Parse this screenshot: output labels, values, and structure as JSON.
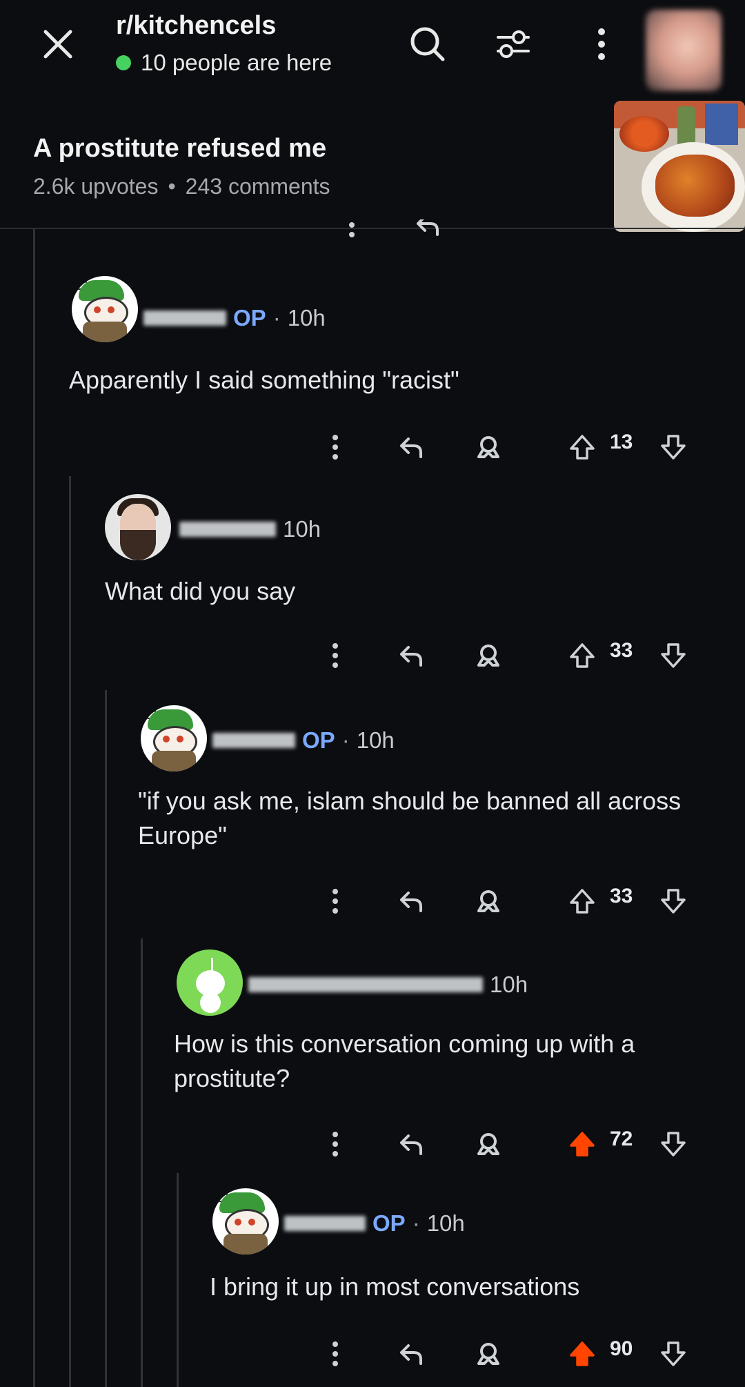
{
  "header": {
    "subreddit": "r/kitchencels",
    "online": "10 people are here",
    "post_title": "A prostitute refused me",
    "upvotes": "2.6k upvotes",
    "separator": "•",
    "comments": "243 comments",
    "accent_online": "#46d160"
  },
  "comments": [
    {
      "op": "OP",
      "time": "10h",
      "text": "Apparently I said something \"racist\"",
      "score": "13",
      "upvoted": false
    },
    {
      "op": "",
      "time": "10h",
      "text": "What did you say",
      "score": "33",
      "upvoted": false
    },
    {
      "op": "OP",
      "time": "10h",
      "text": "\"if you ask me, islam should be banned all across Europe\"",
      "score": "33",
      "upvoted": false
    },
    {
      "op": "",
      "time": "10h",
      "text": "How is this conversation coming up with a prostitute?",
      "score": "72",
      "upvoted": true
    },
    {
      "op": "OP",
      "time": "10h",
      "text": "I bring it up in most conversations",
      "score": "90",
      "upvoted": true
    }
  ],
  "dot": "·",
  "colors": {
    "upvote_active": "#ff4500",
    "op_tag": "#7aa9ff",
    "background": "#0b0d10"
  },
  "icons": [
    "close-icon",
    "search-icon",
    "filter-icon",
    "more-icon",
    "reply-icon",
    "award-icon",
    "upvote-icon",
    "downvote-icon"
  ]
}
